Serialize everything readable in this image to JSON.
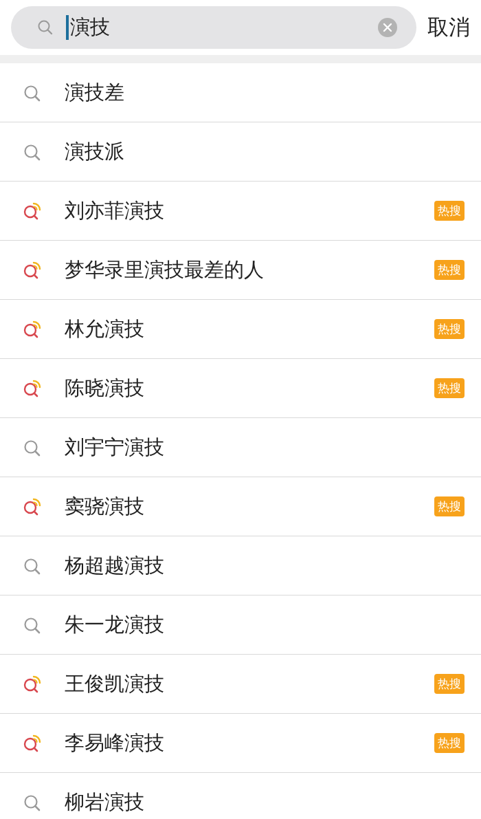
{
  "search": {
    "value": "演技"
  },
  "cancel": "取消",
  "suggestions": [
    {
      "text": "演技差",
      "hot": false
    },
    {
      "text": "演技派",
      "hot": false
    },
    {
      "text": "刘亦菲演技",
      "hot": true,
      "badge": "热搜"
    },
    {
      "text": "梦华录里演技最差的人",
      "hot": true,
      "badge": "热搜"
    },
    {
      "text": "林允演技",
      "hot": true,
      "badge": "热搜"
    },
    {
      "text": "陈晓演技",
      "hot": true,
      "badge": "热搜"
    },
    {
      "text": "刘宇宁演技",
      "hot": false
    },
    {
      "text": "窦骁演技",
      "hot": true,
      "badge": "热搜"
    },
    {
      "text": "杨超越演技",
      "hot": false
    },
    {
      "text": "朱一龙演技",
      "hot": false
    },
    {
      "text": "王俊凯演技",
      "hot": true,
      "badge": "热搜"
    },
    {
      "text": "李易峰演技",
      "hot": true,
      "badge": "热搜"
    },
    {
      "text": "柳岩演技",
      "hot": false
    }
  ]
}
